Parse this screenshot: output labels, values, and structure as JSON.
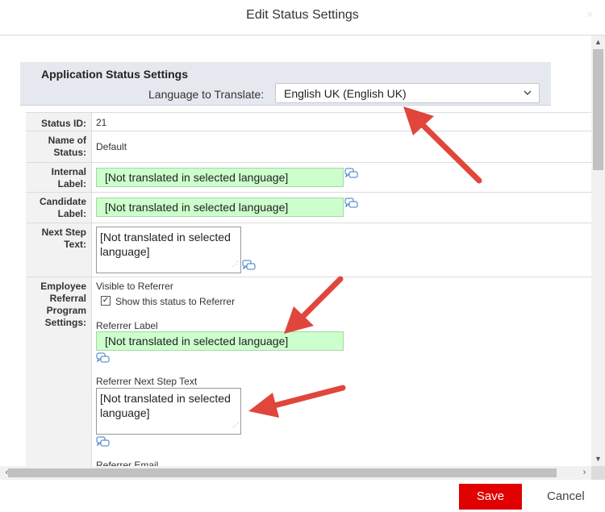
{
  "dialog": {
    "title": "Edit Status Settings",
    "close_icon": "×"
  },
  "section": {
    "title": "Application Status Settings",
    "language_label": "Language to Translate:",
    "language_value": "English UK (English UK)"
  },
  "fields": {
    "status_id": {
      "label": "Status ID:",
      "value": "21"
    },
    "name": {
      "label_line1": "Name of",
      "label_line2": "Status:",
      "value": "Default"
    },
    "internal_label": {
      "label_line1": "Internal",
      "label_line2": "Label:",
      "value": "[Not translated in selected language]"
    },
    "candidate_label": {
      "label_line1": "Candidate",
      "label_line2": "Label:",
      "value": "[Not translated in selected language]"
    },
    "next_step": {
      "label_line1": "Next Step",
      "label_line2": "Text:",
      "value_line1": "[Not translated in selected",
      "value_line2": "language]"
    },
    "referral": {
      "label_line1": "Employee",
      "label_line2": "Referral",
      "label_line3": "Program",
      "label_line4": "Settings:",
      "visible_heading": "Visible to Referrer",
      "checkbox_label": "Show this status to Referrer",
      "checkbox_checked": true,
      "referrer_label_heading": "Referrer Label",
      "referrer_label_value": "[Not translated in selected language]",
      "next_step_heading": "Referrer Next Step Text",
      "next_step_line1": "[Not translated in selected",
      "next_step_line2": "language]",
      "email_heading": "Referrer Email"
    }
  },
  "footer": {
    "save_label": "Save",
    "cancel_label": "Cancel"
  },
  "colors": {
    "accent": "#e00000",
    "annotation_arrow": "#e0463c",
    "translated_input_bg": "#ccffcc"
  },
  "icons": {
    "translate": "translate-bubble-icon",
    "chevron": "chevron-down-icon"
  }
}
